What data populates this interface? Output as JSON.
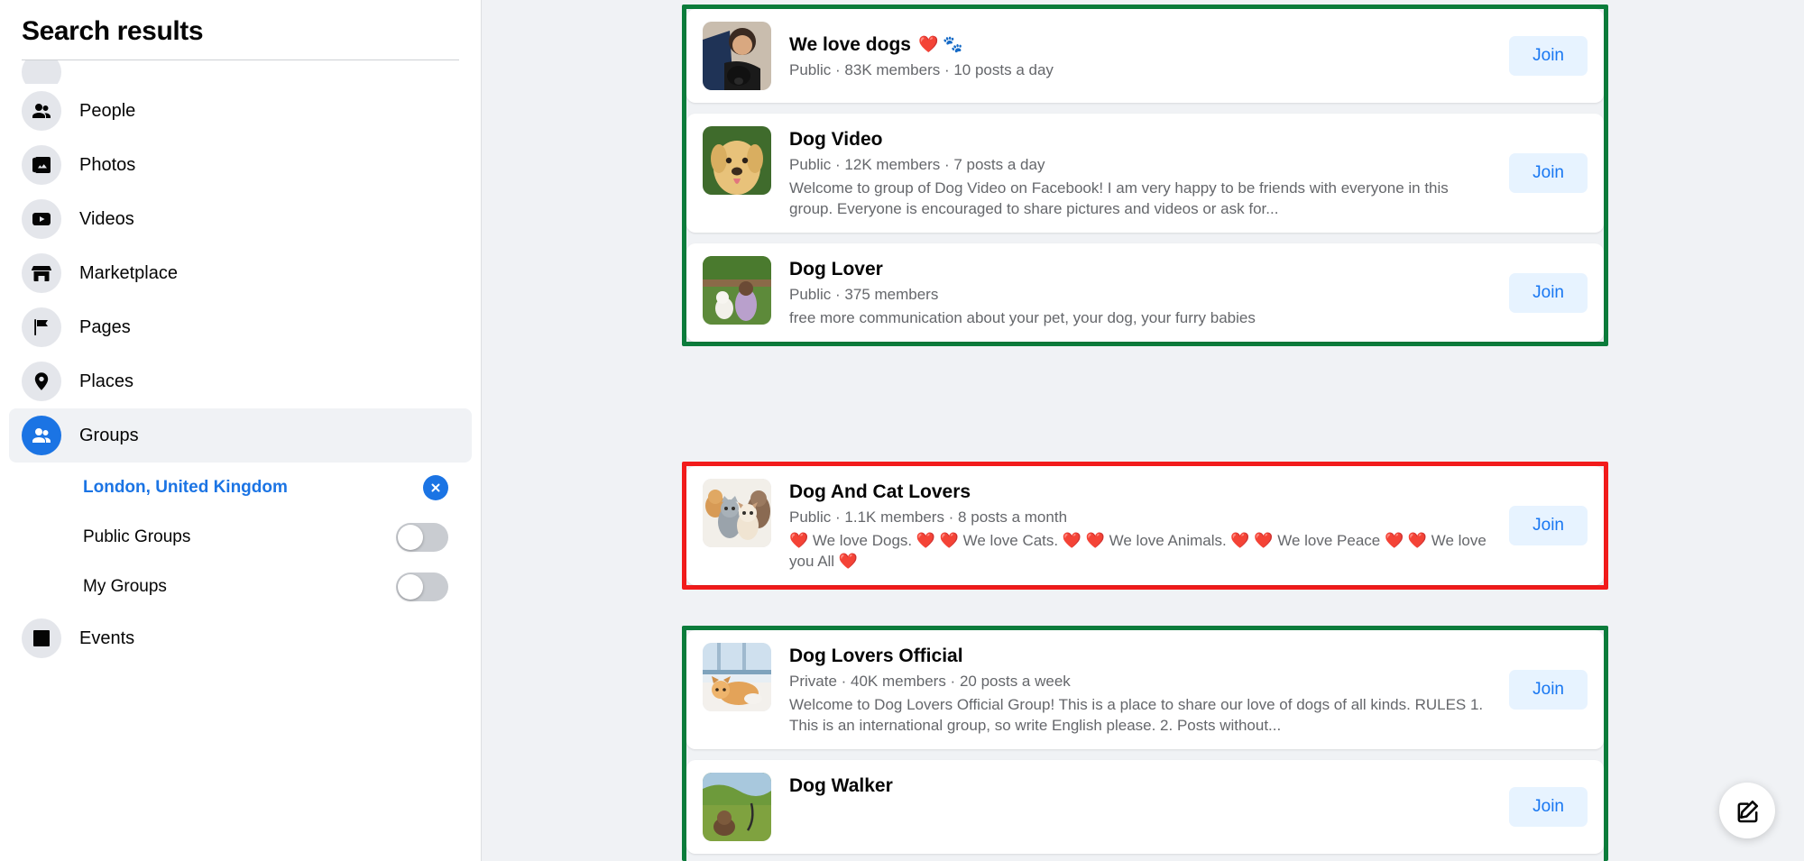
{
  "sidebar": {
    "title": "Search results",
    "nav_items": [
      {
        "label": "",
        "icon": "partial-icon"
      },
      {
        "label": "People",
        "icon": "people-icon"
      },
      {
        "label": "Photos",
        "icon": "photos-icon"
      },
      {
        "label": "Videos",
        "icon": "videos-icon"
      },
      {
        "label": "Marketplace",
        "icon": "marketplace-icon"
      },
      {
        "label": "Pages",
        "icon": "pages-flag-icon"
      },
      {
        "label": "Places",
        "icon": "places-pin-icon"
      },
      {
        "label": "Groups",
        "icon": "groups-icon"
      },
      {
        "label": "Events",
        "icon": "events-icon"
      }
    ],
    "filters": {
      "location": "London, United Kingdom",
      "location_remove_icon": "close-x-icon",
      "public_groups": {
        "label": "Public Groups",
        "state": "off"
      },
      "my_groups": {
        "label": "My Groups",
        "state": "off"
      }
    },
    "active_item": "Groups"
  },
  "colors": {
    "accent_blue": "#1b74e4",
    "join_text": "#1877f2",
    "join_bg": "#e7f3ff",
    "annotation_green": "#0b7c3b",
    "annotation_red": "#f21b1b",
    "page_bg": "#f0f2f5",
    "muted_text": "#65676b"
  },
  "main": {
    "join_label": "Join",
    "fab_icon": "compose-edit-icon",
    "annotations": [
      {
        "color": "green",
        "cards": [
          0,
          1,
          2
        ]
      },
      {
        "color": "red",
        "cards": [
          3
        ]
      },
      {
        "color": "green",
        "cards": [
          4,
          5
        ]
      }
    ],
    "groups": [
      {
        "name": "We love dogs",
        "name_emojis": "❤️ 🐾",
        "meta": "Public · 83K members · 10 posts a day",
        "description": "",
        "thumb": "man-with-black-dog-photo",
        "join_label": "Join"
      },
      {
        "name": "Dog Video",
        "name_emojis": "",
        "meta": "Public · 12K members · 7 posts a day",
        "description": "Welcome to group of Dog Video on Facebook! I am very happy to be friends with everyone in this group. Everyone is encouraged to share pictures and videos or ask for...",
        "thumb": "golden-labrador-photo",
        "join_label": "Join"
      },
      {
        "name": "Dog Lover",
        "name_emojis": "",
        "meta": "Public · 375 members",
        "description": "free more communication about your pet, your dog, your furry babies",
        "thumb": "girl-with-dog-in-garden-photo",
        "join_label": "Join"
      },
      {
        "name": "Dog And Cat Lovers",
        "name_emojis": "",
        "meta": "Public · 1.1K members · 8 posts a month",
        "description": "❤️ We love Dogs. ❤️ ❤️ We love Cats. ❤️ ❤️ We love Animals. ❤️ ❤️ We love Peace ❤️ ❤️ We love you All ❤️",
        "thumb": "cats-and-dogs-group-photo",
        "join_label": "Join"
      },
      {
        "name": "Dog Lovers Official",
        "name_emojis": "",
        "meta": "Private · 40K members · 20 posts a week",
        "description": "Welcome to Dog Lovers Official Group! This is a place to share our love of dogs of all kinds. RULES 1. This is an international group, so write English please. 2. Posts without...",
        "thumb": "shiba-inu-on-rug-photo",
        "join_label": "Join"
      },
      {
        "name": "Dog Walker",
        "name_emojis": "",
        "meta": "",
        "description": "",
        "thumb": "dog-walking-outdoors-photo",
        "join_label": "Join"
      }
    ]
  }
}
